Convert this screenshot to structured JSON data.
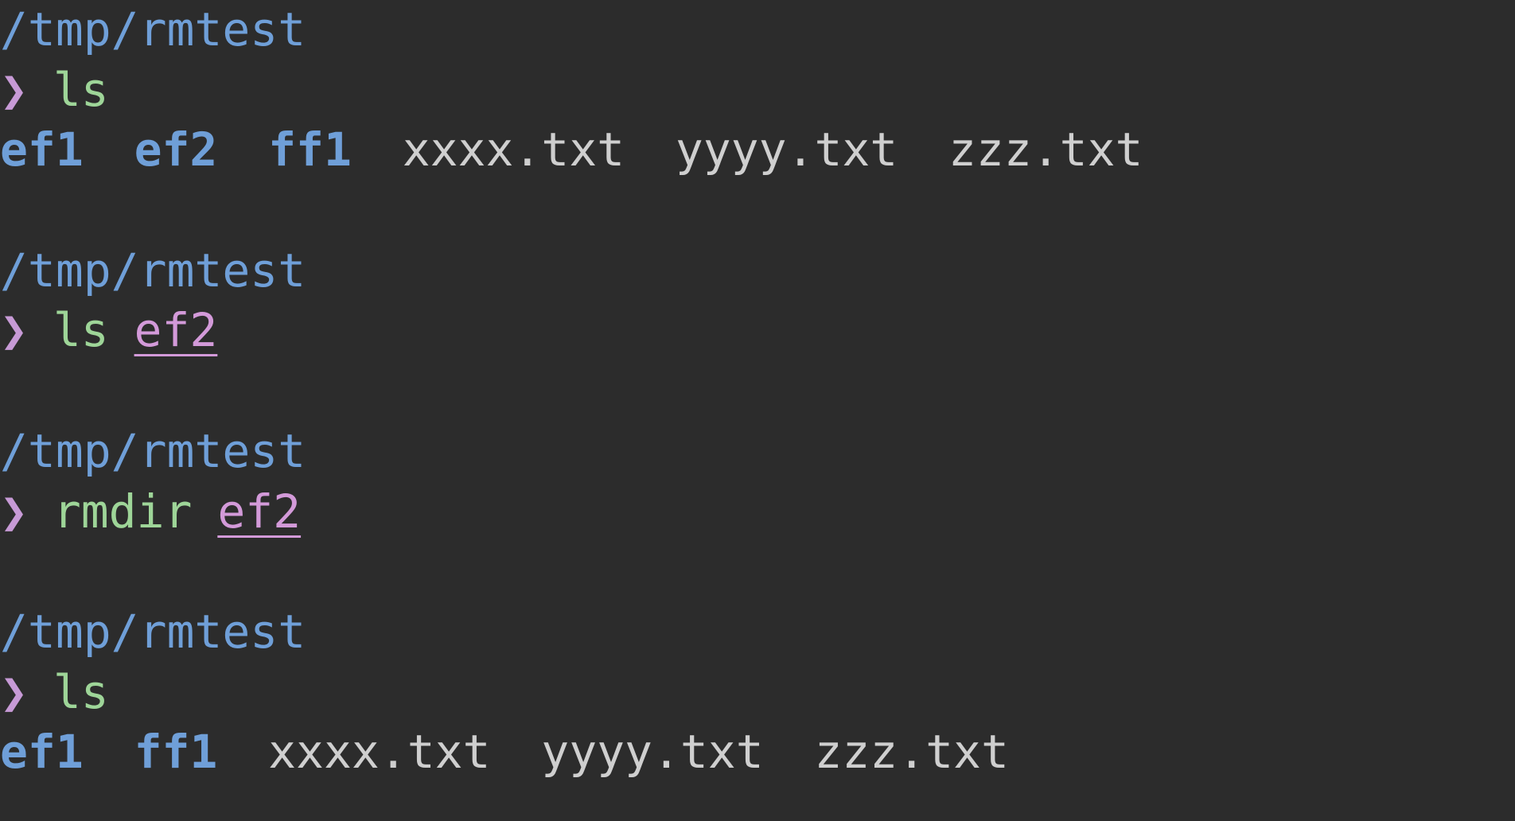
{
  "colors": {
    "background": "#2c2c2c",
    "path": "#6f9fd8",
    "prompt": "#c79ad6",
    "command": "#9ed598",
    "argument": "#d39ad9",
    "directory": "#6f9fd8",
    "file": "#cfcfcf"
  },
  "prompt_symbol": "❯",
  "blocks": [
    {
      "path": "/tmp/rmtest",
      "command": "ls",
      "argument": null,
      "output": {
        "dirs": [
          "ef1",
          "ef2",
          "ff1"
        ],
        "files": [
          "xxxx.txt",
          "yyyy.txt",
          "zzz.txt"
        ]
      }
    },
    {
      "path": "/tmp/rmtest",
      "command": "ls",
      "argument": "ef2",
      "output": null
    },
    {
      "path": "/tmp/rmtest",
      "command": "rmdir",
      "argument": "ef2",
      "output": null
    },
    {
      "path": "/tmp/rmtest",
      "command": "ls",
      "argument": null,
      "output": {
        "dirs": [
          "ef1",
          "ff1"
        ],
        "files": [
          "xxxx.txt",
          "yyyy.txt",
          "zzz.txt"
        ]
      }
    }
  ]
}
